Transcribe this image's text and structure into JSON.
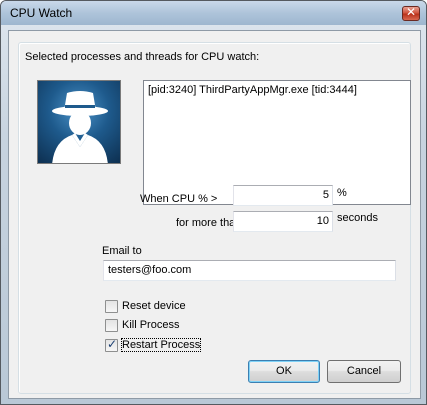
{
  "window": {
    "title": "CPU Watch"
  },
  "group": {
    "label": "Selected processes and threads for CPU watch:"
  },
  "threads": [
    "[pid:3240] ThirdPartyAppMgr.exe [tid:3444]"
  ],
  "cpu": {
    "label": "When CPU % >",
    "value": "5",
    "unit": "%"
  },
  "duration": {
    "label": "for more than",
    "value": "10",
    "unit": "seconds"
  },
  "email": {
    "label": "Email to",
    "value": "testers@foo.com"
  },
  "options": [
    {
      "label": "Reset device",
      "checked": false
    },
    {
      "label": "Kill Process",
      "checked": false
    },
    {
      "label": "Restart Process",
      "checked": true
    }
  ],
  "buttons": {
    "ok": "OK",
    "cancel": "Cancel"
  },
  "icons": {
    "close": "close-icon",
    "avatar": "spy-silhouette-icon"
  },
  "colors": {
    "avatar_bg": "#1e5a8c",
    "close_btn": "#c8452f"
  }
}
